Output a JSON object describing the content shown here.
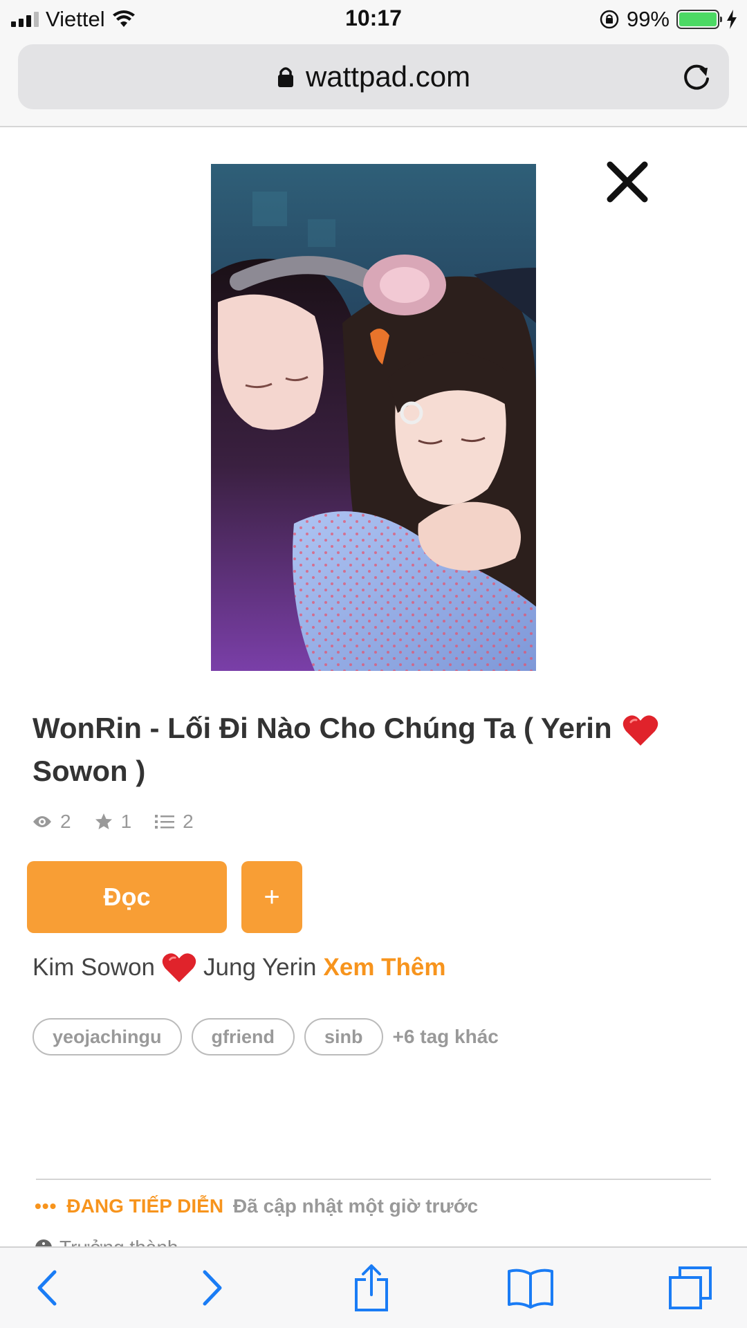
{
  "status_bar": {
    "carrier": "Viettel",
    "time": "10:17",
    "battery": "99%"
  },
  "browser": {
    "url": "wattpad.com"
  },
  "story": {
    "title_part1": "WonRin - Lối Đi Nào Cho Chúng Ta ( Yerin",
    "title_part2": "Sowon )",
    "stats": {
      "views": "2",
      "votes": "1",
      "parts": "2"
    },
    "read_button": "Đọc",
    "add_button": "+",
    "description_part1": "Kim Sowon",
    "description_part2": "Jung Yerin",
    "see_more": "Xem Thêm",
    "tags": [
      "yeojachingu",
      "gfriend",
      "sinb"
    ],
    "more_tags": "+6 tag khác",
    "status_label": "ĐANG TIẾP DIỄN",
    "updated": "Đã cập nhật một giờ trước",
    "mature": "Trưởng thành",
    "status_dots": "•••"
  },
  "colors": {
    "accent": "#f89e35",
    "link": "#f7941d",
    "ios_blue": "#1a7cf5",
    "heart": "#e0232b"
  },
  "icons": [
    "signal-icon",
    "wifi-icon",
    "rotation-lock-icon",
    "battery-icon",
    "charging-icon",
    "lock-icon",
    "reload-icon",
    "close-icon",
    "eye-icon",
    "star-icon",
    "list-icon",
    "heart-icon",
    "info-icon",
    "back-icon",
    "forward-icon",
    "share-icon",
    "bookmarks-icon",
    "tabs-icon"
  ]
}
